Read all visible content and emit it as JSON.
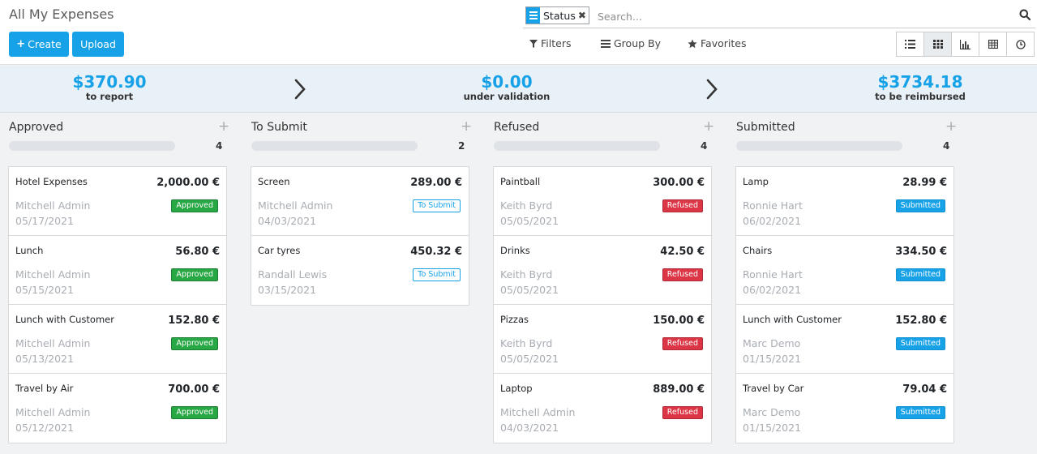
{
  "header": {
    "title": "All My Expenses",
    "create_label": "Create",
    "upload_label": "Upload"
  },
  "search": {
    "facet_label": "Status",
    "placeholder": "Search..."
  },
  "options": {
    "filters": "Filters",
    "group_by": "Group By",
    "favorites": "Favorites"
  },
  "views": [
    "list-view-icon",
    "kanban-view-icon",
    "graph-view-icon",
    "pivot-view-icon",
    "activity-view-icon"
  ],
  "dashboard": {
    "to_report_amount": "$370.90",
    "to_report_label": "to report",
    "validation_amount": "$0.00",
    "validation_label": "under validation",
    "reimbursed_amount": "$3734.18",
    "reimbursed_label": "to be reimbursed"
  },
  "colors": {
    "accent": "#17a2e8",
    "approved": "#28a745",
    "refused": "#dc3545"
  },
  "columns": [
    {
      "title": "Approved",
      "count": "4",
      "cards": [
        {
          "name": "Hotel Expenses",
          "amount": "2,000.00 €",
          "employee": "Mitchell Admin",
          "date": "05/17/2021",
          "status": "Approved"
        },
        {
          "name": "Lunch",
          "amount": "56.80 €",
          "employee": "Mitchell Admin",
          "date": "05/15/2021",
          "status": "Approved"
        },
        {
          "name": "Lunch with Customer",
          "amount": "152.80 €",
          "employee": "Mitchell Admin",
          "date": "05/13/2021",
          "status": "Approved"
        },
        {
          "name": "Travel by Air",
          "amount": "700.00 €",
          "employee": "Mitchell Admin",
          "date": "05/12/2021",
          "status": "Approved"
        }
      ]
    },
    {
      "title": "To Submit",
      "count": "2",
      "cards": [
        {
          "name": "Screen",
          "amount": "289.00 €",
          "employee": "Mitchell Admin",
          "date": "04/03/2021",
          "status": "To Submit"
        },
        {
          "name": "Car tyres",
          "amount": "450.32 €",
          "employee": "Randall Lewis",
          "date": "03/15/2021",
          "status": "To Submit"
        }
      ]
    },
    {
      "title": "Refused",
      "count": "4",
      "cards": [
        {
          "name": "Paintball",
          "amount": "300.00 €",
          "employee": "Keith Byrd",
          "date": "05/05/2021",
          "status": "Refused"
        },
        {
          "name": "Drinks",
          "amount": "42.50 €",
          "employee": "Keith Byrd",
          "date": "05/05/2021",
          "status": "Refused"
        },
        {
          "name": "Pizzas",
          "amount": "150.00 €",
          "employee": "Keith Byrd",
          "date": "05/05/2021",
          "status": "Refused"
        },
        {
          "name": "Laptop",
          "amount": "889.00 €",
          "employee": "Mitchell Admin",
          "date": "04/03/2021",
          "status": "Refused"
        }
      ]
    },
    {
      "title": "Submitted",
      "count": "4",
      "cards": [
        {
          "name": "Lamp",
          "amount": "28.99 €",
          "employee": "Ronnie Hart",
          "date": "06/02/2021",
          "status": "Submitted"
        },
        {
          "name": "Chairs",
          "amount": "334.50 €",
          "employee": "Ronnie Hart",
          "date": "06/02/2021",
          "status": "Submitted"
        },
        {
          "name": "Lunch with Customer",
          "amount": "152.80 €",
          "employee": "Marc Demo",
          "date": "01/15/2021",
          "status": "Submitted"
        },
        {
          "name": "Travel by Car",
          "amount": "79.04 €",
          "employee": "Marc Demo",
          "date": "01/15/2021",
          "status": "Submitted"
        }
      ]
    }
  ]
}
